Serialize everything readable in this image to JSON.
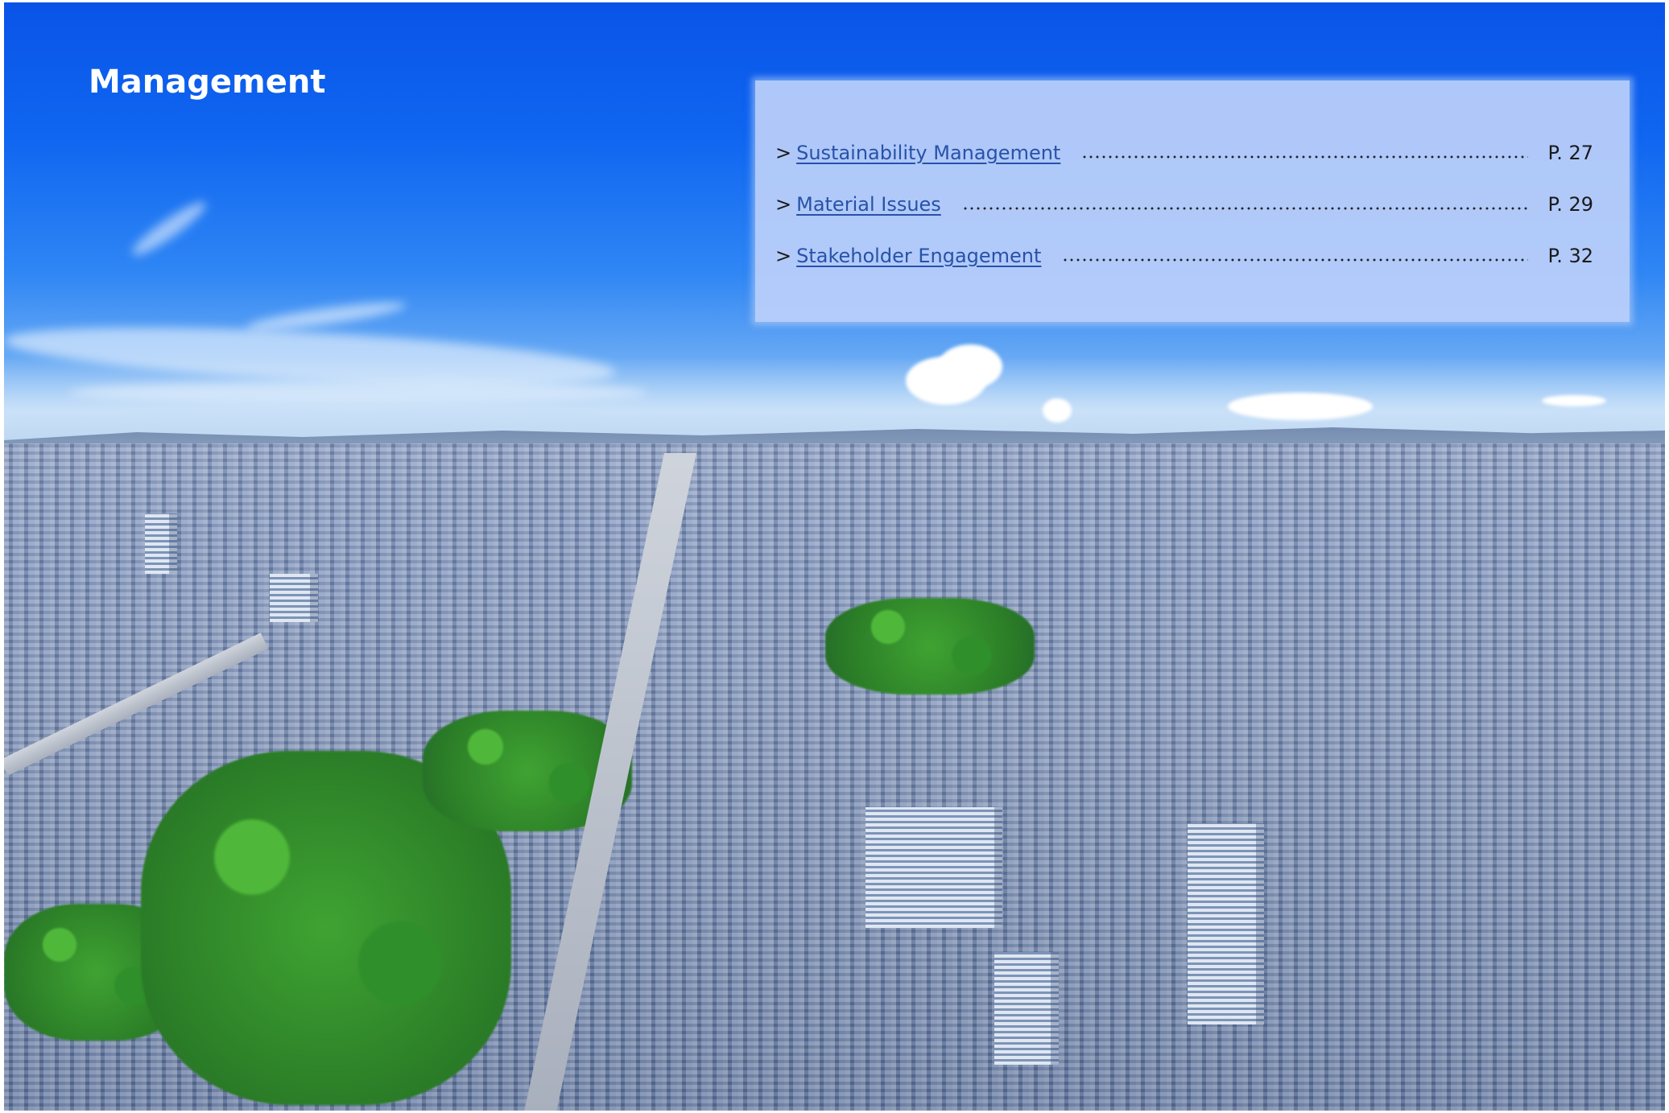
{
  "page": {
    "title": "Management"
  },
  "toc": {
    "items": [
      {
        "marker": ">",
        "label": "Sustainability Management",
        "page": "P. 27"
      },
      {
        "marker": ">",
        "label": "Material Issues",
        "page": "P. 29"
      },
      {
        "marker": ">",
        "label": "Stakeholder Engagement",
        "page": "P. 32"
      }
    ]
  },
  "background": {
    "description_icon": "city-skyline-photo",
    "sky_color": "#0f66f0",
    "panel_color": "#bbd0fa",
    "link_color": "#2852a8"
  }
}
